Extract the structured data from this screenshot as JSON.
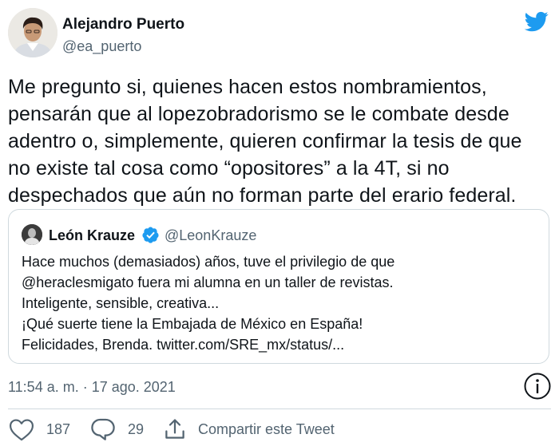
{
  "author": {
    "name": "Alejandro Puerto",
    "handle": "@ea_puerto"
  },
  "tweet": {
    "text": "Me pregunto si, quienes hacen estos nombramientos,\npensarán que al lopezobradorismo se le combate desde\nadentro o, simplemente, quieren confirmar la tesis de que\nno existe tal cosa como “opositores” a la 4T, si no\ndespechados que aún no forman parte del erario federal."
  },
  "quoted_tweet": {
    "name": "León Krauze",
    "verified": true,
    "handle": "@LeonKrauze",
    "text": "Hace muchos (demasiados) años, tuve el privilegio de que\n@heraclesmigato fuera mi alumna en un taller de revistas.\nInteligente, sensible, creativa...\n¡Qué suerte tiene la Embajada de México en España!\nFelicidades, Brenda. twitter.com/SRE_mx/status/..."
  },
  "meta": {
    "timestamp": "11:54 a. m. · 17 ago. 2021"
  },
  "actions": {
    "likes": "187",
    "replies": "29",
    "share_label": "Compartir este Tweet"
  },
  "icons": [
    "twitter-bird-icon",
    "verified-badge-icon",
    "info-icon",
    "heart-icon",
    "reply-bubble-icon",
    "share-icon"
  ],
  "colors": {
    "brand": "#1d9bf0",
    "text": "#0f1419",
    "secondary": "#536471",
    "border": "#cfd9de"
  }
}
